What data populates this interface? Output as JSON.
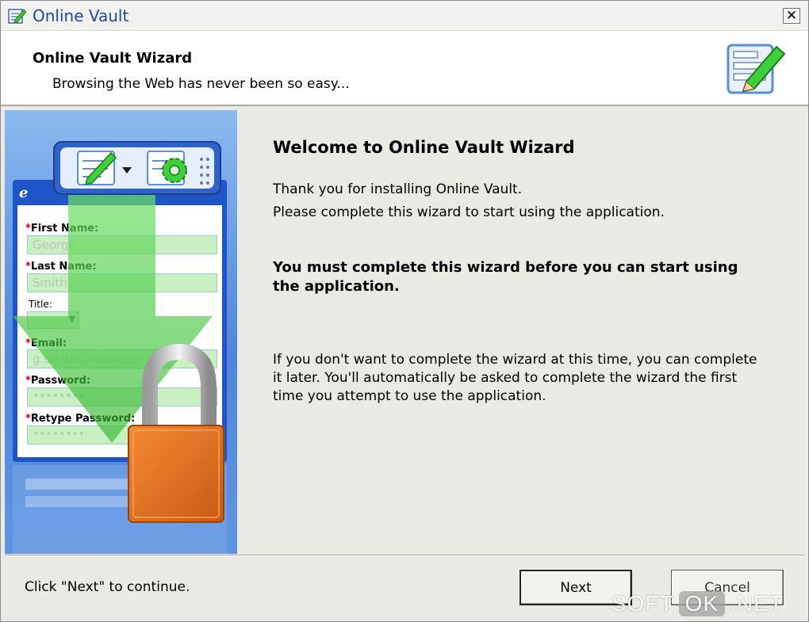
{
  "window": {
    "title": "Online Vault",
    "close_glyph": "✕"
  },
  "header": {
    "title": "Online Vault Wizard",
    "subtitle": "Browsing the Web has never been so easy..."
  },
  "side_form": {
    "first_name_label": "First Name:",
    "first_name_value": "George",
    "last_name_label": "Last Name:",
    "last_name_value": "Smith",
    "title_label": "Title:",
    "email_label": "Email:",
    "email_value": "g.smith@inbox.co",
    "password_label": "Password:",
    "password_value": "••••••••",
    "retype_label": "Retype Password:",
    "retype_value": "••••••••"
  },
  "content": {
    "welcome": "Welcome to Online Vault Wizard",
    "line1": "Thank you for installing Online Vault.",
    "line2": "Please complete this wizard to start using the application.",
    "bold_notice": "You must complete this wizard before you can start using the application.",
    "later_notice": "If you don't want to complete the wizard at this time, you can complete it later. You'll automatically be asked to complete the wizard the first time you attempt to use the application."
  },
  "footer": {
    "hint": "Click \"Next\" to continue.",
    "next_label": "Next",
    "cancel_label": "Cancel"
  },
  "watermark": {
    "left": "SOFT",
    "middle": "OK",
    "right": ".NET"
  },
  "colors": {
    "title_text": "#22469a",
    "panel_blue": "#4f86d9",
    "arrow_green": "#3fcf3a",
    "lock_orange": "#e8731c"
  },
  "icons": {
    "app": "notepad-pencil-icon",
    "header": "notepad-pencil-icon",
    "close": "close-icon",
    "toolbar_edit": "pencil-form-icon",
    "toolbar_settings": "gear-form-icon",
    "lock": "padlock-icon"
  }
}
